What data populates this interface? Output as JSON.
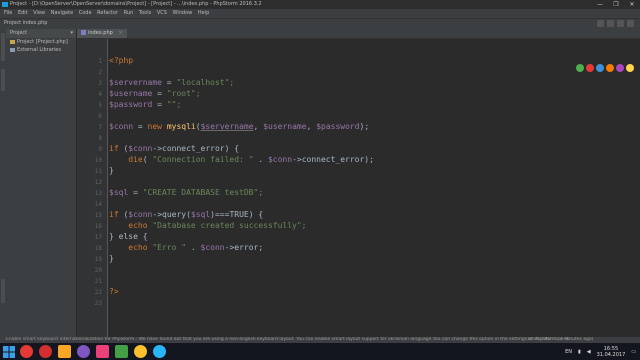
{
  "window": {
    "title": "Project - [D:\\OpenServer\\OpenServer\\domains\\Project] - [Project] - ...\\index.php - PhpStorm 2016.3.2",
    "controls": [
      "—",
      "❐",
      "✕"
    ]
  },
  "menu": [
    "File",
    "Edit",
    "View",
    "Navigate",
    "Code",
    "Refactor",
    "Run",
    "Tools",
    "VCS",
    "Window",
    "Help"
  ],
  "breadcrumb": "Project    index.php",
  "project_panel": {
    "header": "Project",
    "items": [
      {
        "label": "Project [Project.php]",
        "icon": "folder-icon"
      },
      {
        "label": "External Libraries",
        "icon": "library-icon"
      }
    ]
  },
  "editor_tab": {
    "label": "index.php",
    "close": "×"
  },
  "line_numbers": [
    "1",
    "2",
    "3",
    "4",
    "5",
    "6",
    "7",
    "8",
    "9",
    "10",
    "11",
    "12",
    "13",
    "14",
    "15",
    "16",
    "17",
    "18",
    "19",
    "20",
    "21",
    "22",
    "23"
  ],
  "code": {
    "l1": "<?php",
    "l3_var": "$servername",
    "l3_val": "\"localhost\";",
    "l4_var": "$username",
    "l4_val": "\"root\";",
    "l5_var": "$password",
    "l5_val": "\"\";",
    "l7_var": "$conn",
    "l7_kw": "new",
    "l7_fn": "mysqli",
    "l7_a1": "$servername",
    "l7_a2": "$username",
    "l7_a3": "$password",
    "l9_kw": "if",
    "l9_rest": "->connect_error) {",
    "l10_kw": "die",
    "l10_str": "\"Connection failed: \"",
    "l10_rest": "->connect_error);",
    "l13_var": "$sql",
    "l13_str": "\"CREATE DATABASE testDB\";",
    "l15_kw": "if",
    "l15_mid": "->query(",
    "l15_rest": ")===TRUE) {",
    "l16_kw": "echo",
    "l16_str": "\"Database created successfully\";",
    "l17_mid": "} else {",
    "l18_kw": "echo",
    "l18_str": "\"Erro \"",
    "l18_rest": "->error;",
    "l23": "?>"
  },
  "status": {
    "message": "Enable smart keyboard internationalization for PhpStorm.: We have found out that you are using a non-english keyboard layout. You can enable smart layout support for ukrainian language.You can change this option in the settings of PhpStorm (3 minutes ago)",
    "position": "18:31  CRLF:  UTF-8:"
  },
  "taskbar": {
    "apps": [
      "chrome-icon",
      "opera-icon",
      "yandex-icon",
      "viber-icon",
      "phpstorm-icon",
      "camtasia-icon",
      "chrome-icon-2",
      "skype-icon"
    ],
    "lang": "EN",
    "time": "16:55",
    "date": "31.04.2017"
  },
  "colors": {
    "keyword": "#cc7832",
    "variable": "#9876aa",
    "string": "#6a8759",
    "function": "#ffc66d",
    "default": "#a9b7c6"
  }
}
